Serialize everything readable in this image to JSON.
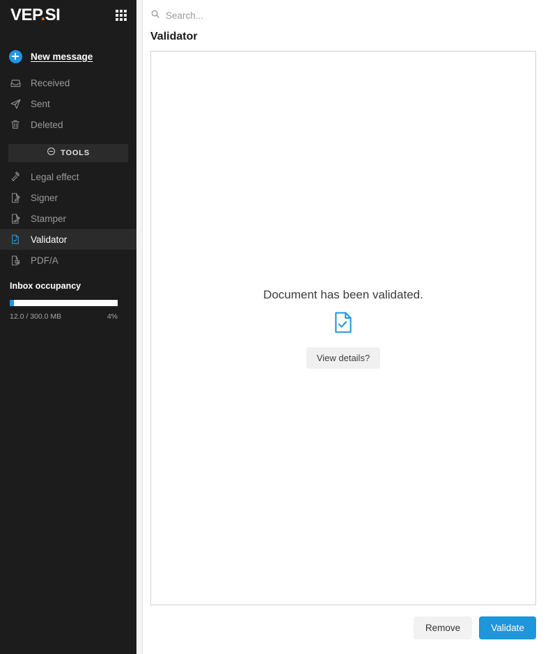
{
  "brand": {
    "logo_prefix": "VEP",
    "logo_dot": ".",
    "logo_suffix": "SI",
    "accent_orange": "#e8761e",
    "apps_icon": "grid-apps-icon"
  },
  "sidebar": {
    "background": "#1c1c1c",
    "primary": [
      {
        "label": "New message",
        "icon": "plus-circle-icon",
        "active": true
      },
      {
        "label": "Received",
        "icon": "inbox-icon",
        "active": false
      },
      {
        "label": "Sent",
        "icon": "paper-plane-icon",
        "active": false
      },
      {
        "label": "Deleted",
        "icon": "trash-icon",
        "active": false
      }
    ],
    "tools_header": {
      "label": "TOOLS",
      "icon": "minus-circle-icon"
    },
    "tools": [
      {
        "label": "Legal effect",
        "icon": "gavel-icon",
        "active": false
      },
      {
        "label": "Signer",
        "icon": "document-pen-icon",
        "active": false
      },
      {
        "label": "Stamper",
        "icon": "document-stamp-icon",
        "active": false
      },
      {
        "label": "Validator",
        "icon": "document-check-icon",
        "active": true
      },
      {
        "label": "PDF/A",
        "icon": "pdf-convert-icon",
        "active": false
      }
    ],
    "storage": {
      "title": "Inbox occupancy",
      "used_label": "12.0 / 300.0 MB",
      "percent_label": "4%",
      "percent_value": 4,
      "fill_color": "#2196e3"
    }
  },
  "search": {
    "placeholder": "Search...",
    "value": "",
    "icon": "search-icon"
  },
  "main": {
    "page_title": "Validator",
    "panel": {
      "status_text": "Document has been validated.",
      "status_icon": "document-check-icon",
      "status_icon_color": "#1d96da",
      "details_button": "View details?"
    },
    "actions": {
      "remove_label": "Remove",
      "validate_label": "Validate",
      "validate_color": "#1d96da"
    }
  }
}
